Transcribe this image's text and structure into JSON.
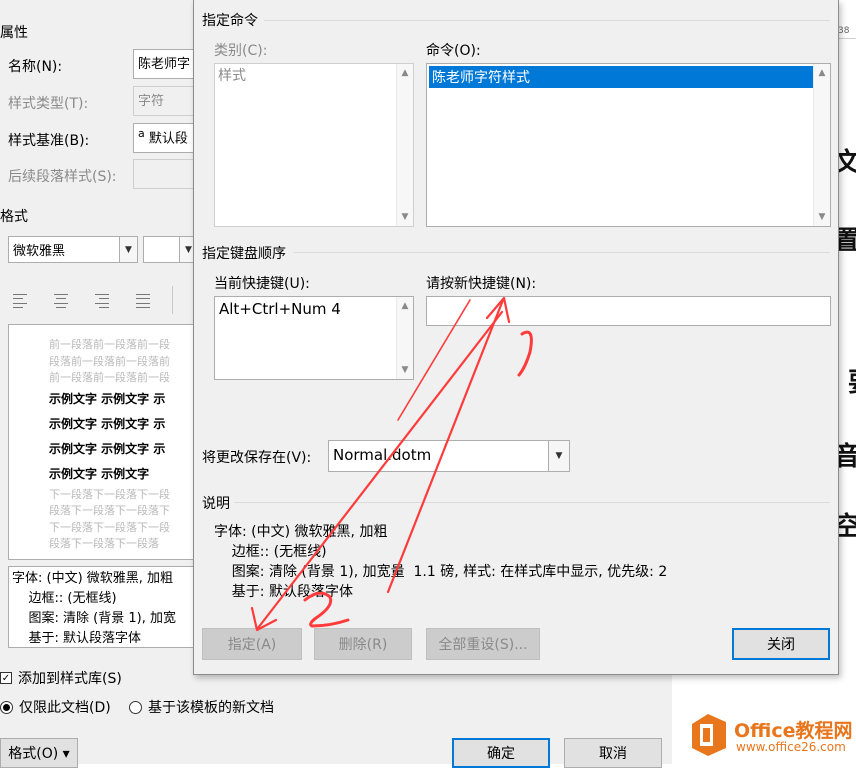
{
  "bg_dialog": {
    "properties_header": "属性",
    "name_label": "名称(N):",
    "name_value": "陈老师字",
    "style_type_label": "样式类型(T):",
    "style_type_value": "字符",
    "style_based_label": "样式基准(B):",
    "style_based_value": "默认段",
    "style_based_icon_glyph": "a",
    "following_label": "后续段落样式(S):",
    "format_header": "格式",
    "font_value": "微软雅黑",
    "preview": {
      "gray_before": [
        "前一段落前一段落前一段",
        "段落前一段落前一段落前",
        "前一段落前一段落前一段"
      ],
      "bold_lines": [
        "示例文字  示例文字  示",
        "示例文字  示例文字  示",
        "示例文字  示例文字  示",
        "示例文字  示例文字"
      ],
      "gray_after": [
        "下一段落下一段落下一段",
        "段落下一段落下一段落下",
        "下一段落下一段落下一段",
        "段落下一段落下一段落"
      ]
    },
    "description_lines": [
      "字体: (中文) 微软雅黑, 加粗",
      "    边框:: (无框线)",
      "    图案: 清除 (背景 1), 加宽",
      "    基于: 默认段落字体"
    ],
    "add_to_gallery_label": "添加到样式库(S)",
    "only_this_doc_label": "仅限此文档(D)",
    "new_docs_template_label": "基于该模板的新文档",
    "format_button_label": "格式(O) ▾",
    "ok_label": "确定",
    "cancel_label": "取消"
  },
  "dialog": {
    "specify_command_title": "指定命令",
    "categories_label": "类别(C):",
    "categories_items": [
      "样式"
    ],
    "commands_label": "命令(O):",
    "commands_items": [
      "陈老师字符样式"
    ],
    "keyboard_sequence_title": "指定键盘顺序",
    "current_keys_label": "当前快捷键(U):",
    "current_keys_items": [
      "Alt+Ctrl+Num 4"
    ],
    "new_shortcut_label": "请按新快捷键(N):",
    "new_shortcut_value": "",
    "save_changes_label": "将更改保存在(V):",
    "save_changes_value": "Normal.dotm",
    "description_title": "说明",
    "description_lines": [
      "字体: (中文) 微软雅黑, 加粗",
      "    边框:: (无框线)",
      "    图案: 清除 (背景 1), 加宽量  1.1 磅, 样式: 在样式库中显示, 优先级: 2",
      "    基于: 默认段落字体"
    ],
    "assign_label": "指定(A)",
    "remove_label": "删除(R)",
    "reset_all_label": "全部重设(S)...",
    "close_label": "关闭"
  },
  "document": {
    "ruler_text": "38",
    "glyphs": [
      "文",
      "置",
      "要",
      "音",
      "空"
    ]
  },
  "logo": {
    "title": "Office教程网",
    "url": "www.office26.com",
    "brand_color": "#e8761d"
  },
  "annotations": {
    "marks": [
      "1",
      "2"
    ],
    "color": "#ff3b3b"
  },
  "colors": {
    "selection": "#0078d7",
    "dialog_bg": "#f0f0f0"
  }
}
